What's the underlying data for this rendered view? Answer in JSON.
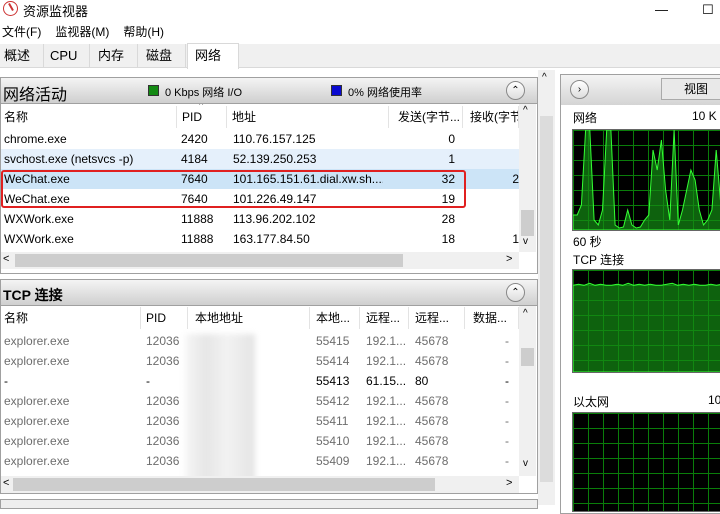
{
  "window": {
    "title": "资源监视器",
    "minimize": "—",
    "maximize": "☐"
  },
  "menu": [
    "文件(F)",
    "监视器(M)",
    "帮助(H)"
  ],
  "tabs": [
    "概述",
    "CPU",
    "内存",
    "磁盘",
    "网络"
  ],
  "network_activity": {
    "title": "网络活动",
    "io_label": "0 Kbps 网络 I/O",
    "usage_label": "0% 网络使用率",
    "io_color": "#138a13",
    "usage_color": "#0a0ad0",
    "columns": [
      "名称",
      "PID",
      "地址",
      "发送(字节...",
      "接收(字节"
    ],
    "rows": [
      {
        "name": "chrome.exe",
        "pid": "2420",
        "addr": "110.76.157.125",
        "send": "0",
        "recv": ""
      },
      {
        "name": "svchost.exe (netsvcs -p)",
        "pid": "4184",
        "addr": "52.139.250.253",
        "send": "1",
        "recv": ""
      },
      {
        "name": "WeChat.exe",
        "pid": "7640",
        "addr": "101.165.151.61.dial.xw.sh....",
        "send": "32",
        "recv": "2"
      },
      {
        "name": "WeChat.exe",
        "pid": "7640",
        "addr": "101.226.49.147",
        "send": "19",
        "recv": ""
      },
      {
        "name": "WXWork.exe",
        "pid": "11888",
        "addr": "113.96.202.102",
        "send": "28",
        "recv": ""
      },
      {
        "name": "WXWork.exe",
        "pid": "11888",
        "addr": "163.177.84.50",
        "send": "18",
        "recv": "1"
      }
    ]
  },
  "tcp": {
    "title": "TCP 连接",
    "columns": [
      "名称",
      "PID",
      "本地地址",
      "本地...",
      "远程...",
      "远程...",
      "数据..."
    ],
    "rows": [
      {
        "name": "explorer.exe",
        "pid": "12036",
        "laddr": "",
        "lport": "55415",
        "raddr": "192.1...",
        "rport": "45678",
        "loss": "-"
      },
      {
        "name": "explorer.exe",
        "pid": "12036",
        "laddr": "",
        "lport": "55414",
        "raddr": "192.1...",
        "rport": "45678",
        "loss": "-"
      },
      {
        "name": "-",
        "pid": "-",
        "laddr": "",
        "lport": "55413",
        "raddr": "61.15...",
        "rport": "80",
        "loss": "-"
      },
      {
        "name": "explorer.exe",
        "pid": "12036",
        "laddr": "",
        "lport": "55412",
        "raddr": "192.1...",
        "rport": "45678",
        "loss": "-"
      },
      {
        "name": "explorer.exe",
        "pid": "12036",
        "laddr": "",
        "lport": "55411",
        "raddr": "192.1...",
        "rport": "45678",
        "loss": "-"
      },
      {
        "name": "explorer.exe",
        "pid": "12036",
        "laddr": "",
        "lport": "55410",
        "raddr": "192.1...",
        "rport": "45678",
        "loss": "-"
      },
      {
        "name": "explorer.exe",
        "pid": "12036",
        "laddr": "1",
        "lport": "55409",
        "raddr": "192.1...",
        "rport": "45678",
        "loss": "-"
      }
    ]
  },
  "side": {
    "view_label": "视图",
    "net_label": "网络",
    "net_scale": "10 K",
    "time_label": "60 秒",
    "tcp_label": "TCP 连接",
    "eth_label": "以太网",
    "eth_scale": "10",
    "net_series": [
      15,
      15,
      25,
      100,
      100,
      10,
      5,
      20,
      100,
      100,
      5,
      2,
      3,
      20,
      5,
      2,
      3,
      10,
      15,
      80,
      60,
      90,
      40,
      10,
      100,
      5,
      20,
      40,
      60,
      50,
      20,
      5,
      10,
      20,
      80,
      30,
      25,
      10,
      5
    ],
    "tcp_series": [
      85,
      86,
      85,
      87,
      85,
      86,
      85,
      85,
      86,
      85,
      87,
      85,
      86,
      85,
      86,
      85,
      85,
      86,
      87,
      85,
      86,
      85,
      86,
      85,
      85,
      86,
      85,
      86,
      85,
      86
    ]
  }
}
